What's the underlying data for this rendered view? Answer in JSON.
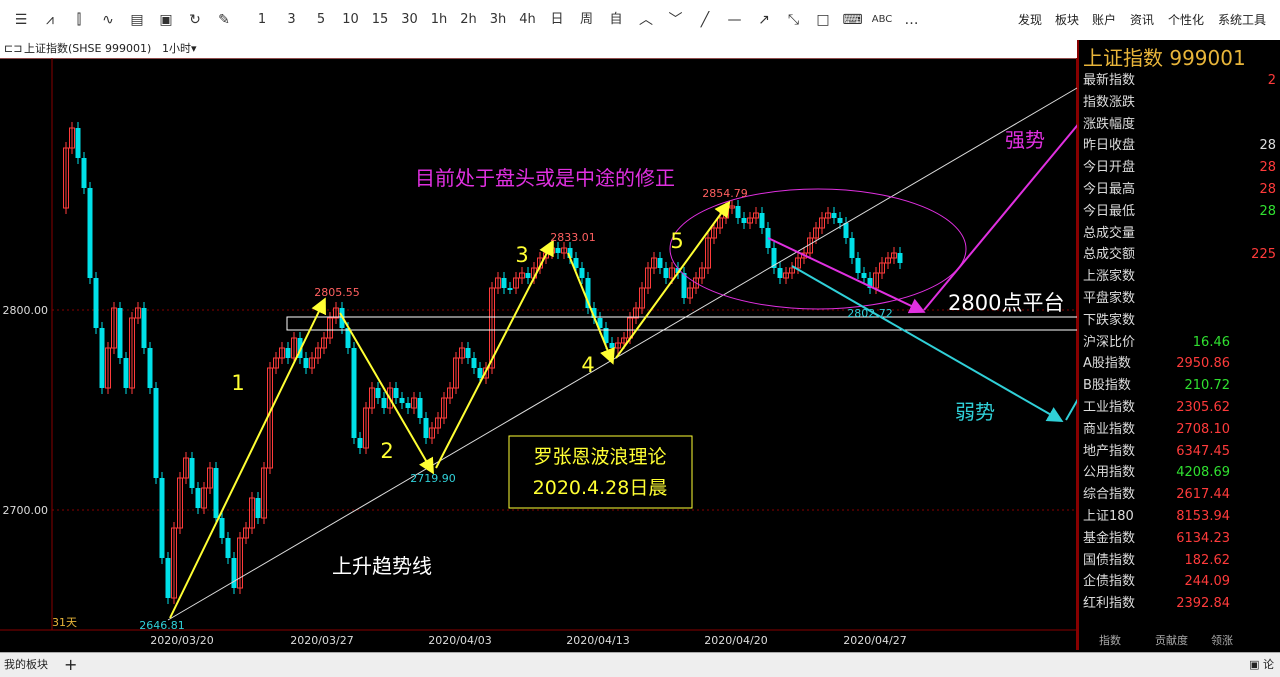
{
  "toolbar": {
    "icons": [
      "list-icon",
      "line-chart-icon",
      "candle-icon",
      "indicator-icon",
      "panel-icon",
      "save-icon",
      "refresh-icon",
      "draw-icon"
    ],
    "periods": [
      "1",
      "3",
      "5",
      "10",
      "15",
      "30",
      "1h",
      "2h",
      "3h",
      "4h",
      "日",
      "周",
      "自"
    ],
    "tools": [
      "up-icon",
      "down-icon",
      "line-icon",
      "h-line-icon",
      "ray-icon",
      "trend-icon",
      "rect-icon",
      "keyboard-icon",
      "ABC",
      "…"
    ],
    "menu": [
      "发现",
      "板块",
      "账户",
      "资讯",
      "个性化",
      "系统工具"
    ]
  },
  "subbar": {
    "symbol_label": "上证指数(SHSE 999001)",
    "period": "1小时"
  },
  "chart": {
    "y_ticks": [
      "2800.00",
      "2700.00"
    ],
    "x_ticks": [
      "2020/03/20",
      "2020/03/27",
      "2020/04/03",
      "2020/04/13",
      "2020/04/20",
      "2020/04/27"
    ],
    "days_label": "31天",
    "price_labels": [
      "2646.81",
      "2805.55",
      "2719.90",
      "2833.01",
      "2854.79",
      "2802.72"
    ],
    "wave_numbers": [
      "1",
      "2",
      "3",
      "4",
      "5"
    ],
    "annotations": {
      "headline": "目前处于盘头或是中途的修正",
      "strong": "强势",
      "weak": "弱势",
      "platform": "2800点平台",
      "trendline": "上升趋势线",
      "theory_line1": "罗张恩波浪理论",
      "theory_line2": "2020.4.28日晨"
    },
    "colors": {
      "up": "#ff3b3b",
      "down": "#00e0e8",
      "wave": "#ffff33",
      "magenta": "#e030e0",
      "cyan": "#30d0d8"
    }
  },
  "right_panel": {
    "title": "上证指数  999001",
    "rows": [
      {
        "label": "最新指数",
        "value": "2",
        "color": "#ff3b3b"
      },
      {
        "label": "指数涨跌",
        "value": "",
        "color": "#ff3b3b"
      },
      {
        "label": "涨跌幅度",
        "value": "",
        "color": "#ff3b3b"
      },
      {
        "label": "昨日收盘",
        "value": "28",
        "color": "#ddd"
      },
      {
        "label": "今日开盘",
        "value": "28",
        "color": "#ff3b3b"
      },
      {
        "label": "今日最高",
        "value": "28",
        "color": "#ff3b3b"
      },
      {
        "label": "今日最低",
        "value": "28",
        "color": "#30e030"
      },
      {
        "label": "总成交量",
        "value": "",
        "color": "#ddd"
      },
      {
        "label": "总成交额",
        "value": "225",
        "color": "#ff3b3b"
      },
      {
        "label": "上涨家数",
        "value": "",
        "color": "#ddd"
      },
      {
        "label": "平盘家数",
        "value": "",
        "color": "#ddd"
      },
      {
        "label": "下跌家数",
        "value": "",
        "color": "#ddd"
      },
      {
        "label": "沪深比价",
        "value": "16.46",
        "color": "#30e030"
      },
      {
        "label": "A股指数",
        "value": "2950.86",
        "color": "#ff3b3b"
      },
      {
        "label": "B股指数",
        "value": "210.72",
        "color": "#30e030"
      },
      {
        "label": "工业指数",
        "value": "2305.62",
        "color": "#ff3b3b"
      },
      {
        "label": "商业指数",
        "value": "2708.10",
        "color": "#ff3b3b"
      },
      {
        "label": "地产指数",
        "value": "6347.45",
        "color": "#ff3b3b"
      },
      {
        "label": "公用指数",
        "value": "4208.69",
        "color": "#30e030"
      },
      {
        "label": "综合指数",
        "value": "2617.44",
        "color": "#ff3b3b"
      },
      {
        "label": "上证180",
        "value": "8153.94",
        "color": "#ff3b3b"
      },
      {
        "label": "基金指数",
        "value": "6134.23",
        "color": "#ff3b3b"
      },
      {
        "label": "国债指数",
        "value": "182.62",
        "color": "#ff3b3b"
      },
      {
        "label": "企债指数",
        "value": "244.09",
        "color": "#ff3b3b"
      },
      {
        "label": "红利指数",
        "value": "2392.84",
        "color": "#ff3b3b"
      }
    ],
    "tabs": [
      "指数",
      "贡献度",
      "领涨"
    ]
  },
  "bottombar": {
    "tab": "我的板块",
    "add": "+",
    "right_text": "论"
  }
}
